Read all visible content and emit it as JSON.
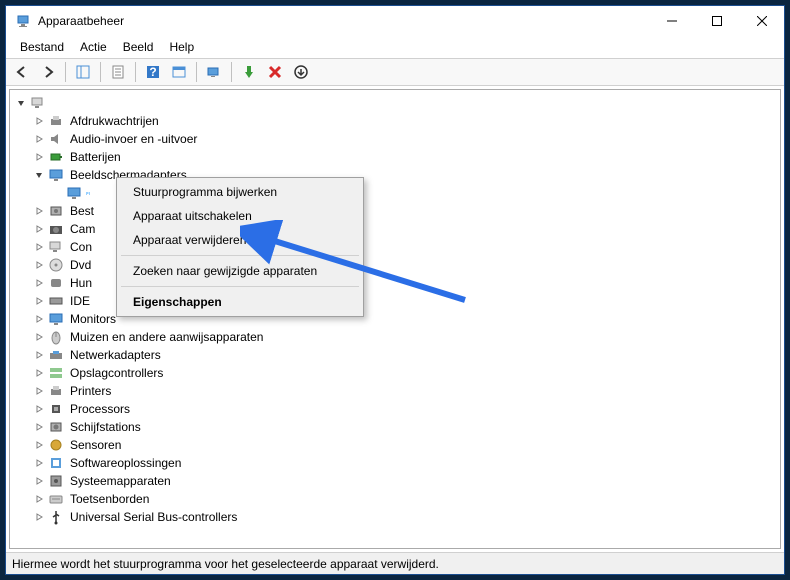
{
  "window": {
    "title": "Apparaatbeheer"
  },
  "menubar": {
    "file": "Bestand",
    "action": "Actie",
    "view": "Beeld",
    "help": "Help"
  },
  "tree": {
    "root": "",
    "categories": [
      {
        "label": "Afdrukwachtrijen",
        "icon": "printer"
      },
      {
        "label": "Audio-invoer en -uitvoer",
        "icon": "audio"
      },
      {
        "label": "Batterijen",
        "icon": "battery"
      },
      {
        "label": "Beeldschermadapters",
        "icon": "display",
        "expanded": true,
        "children": [
          {
            "label": "",
            "icon": "display",
            "selected": true
          }
        ]
      },
      {
        "label": "Best",
        "icon": "hdd",
        "truncated": true
      },
      {
        "label": "Cam",
        "icon": "camera",
        "truncated": true
      },
      {
        "label": "Con",
        "icon": "computer",
        "truncated": true
      },
      {
        "label": "Dvd",
        "icon": "disc",
        "truncated": true
      },
      {
        "label": "Hun",
        "icon": "hid",
        "truncated": true
      },
      {
        "label": "IDE",
        "icon": "ide",
        "truncated": true
      },
      {
        "label": "Monitors",
        "icon": "monitor"
      },
      {
        "label": "Muizen en andere aanwijsapparaten",
        "icon": "mouse"
      },
      {
        "label": "Netwerkadapters",
        "icon": "network"
      },
      {
        "label": "Opslagcontrollers",
        "icon": "storage"
      },
      {
        "label": "Printers",
        "icon": "printer2"
      },
      {
        "label": "Processors",
        "icon": "cpu"
      },
      {
        "label": "Schijfstations",
        "icon": "disk"
      },
      {
        "label": "Sensoren",
        "icon": "sensor"
      },
      {
        "label": "Softwareoplossingen",
        "icon": "software"
      },
      {
        "label": "Systeemapparaten",
        "icon": "system"
      },
      {
        "label": "Toetsenborden",
        "icon": "keyboard"
      },
      {
        "label": "Universal Serial Bus-controllers",
        "icon": "usb"
      }
    ]
  },
  "contextmenu": {
    "update_driver": "Stuurprogramma bijwerken",
    "disable_device": "Apparaat uitschakelen",
    "remove_device": "Apparaat verwijderen",
    "scan_hardware": "Zoeken naar gewijzigde apparaten",
    "properties": "Eigenschappen"
  },
  "statusbar": {
    "text": "Hiermee wordt het stuurprogramma voor het geselecteerde apparaat verwijderd."
  }
}
